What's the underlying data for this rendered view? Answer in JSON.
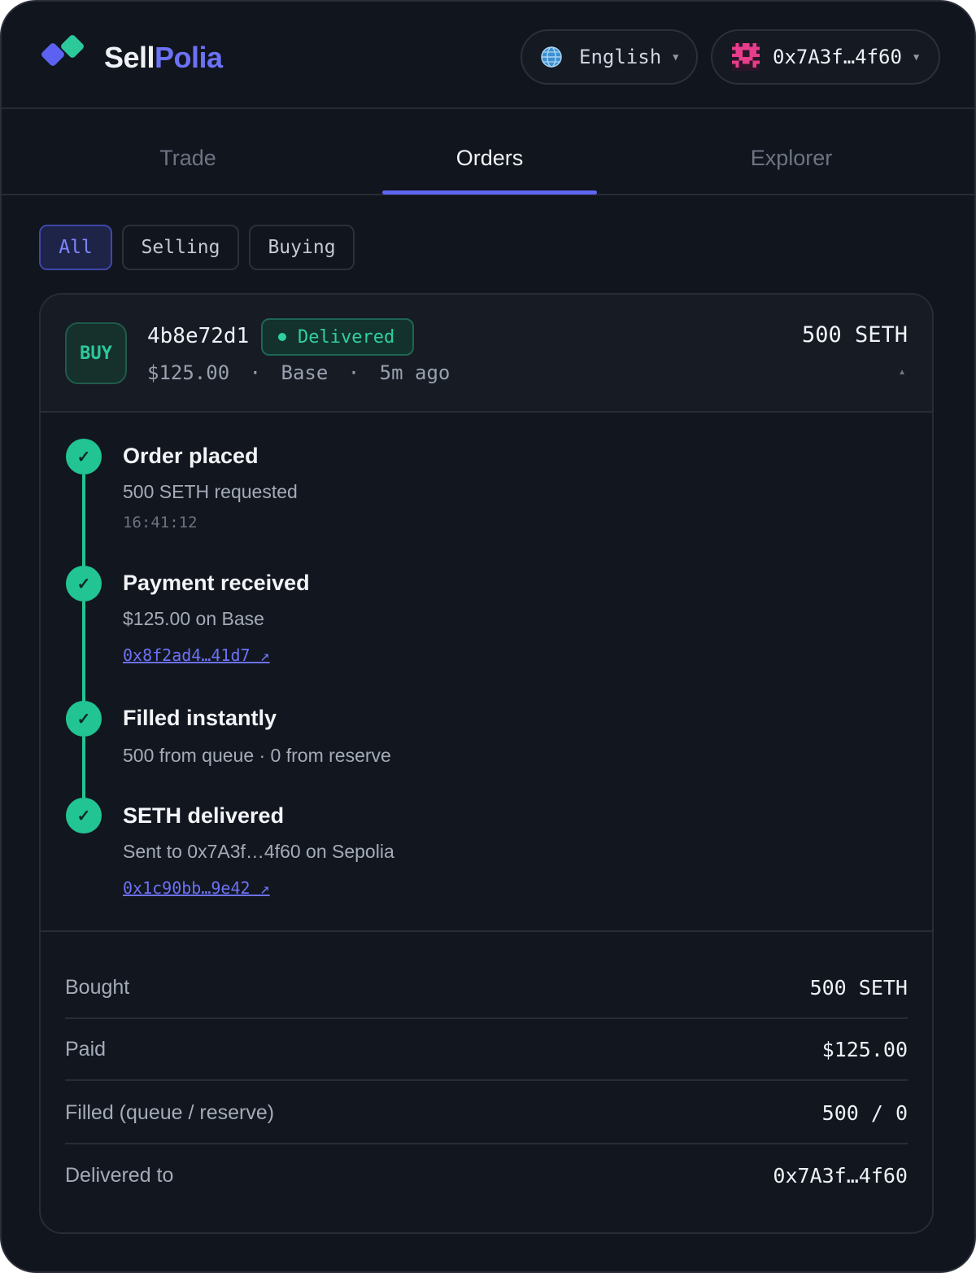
{
  "brand": {
    "part1": "Sell",
    "part2": "Polia"
  },
  "header": {
    "language": {
      "label": "English",
      "icon": "globe-icon"
    },
    "wallet": {
      "address": "0x7A3f…4f60",
      "icon": "wallet-avatar-icon"
    }
  },
  "tabs": [
    {
      "label": "Trade",
      "active": false
    },
    {
      "label": "Orders",
      "active": true
    },
    {
      "label": "Explorer",
      "active": false
    }
  ],
  "filters": [
    {
      "label": "All",
      "active": true
    },
    {
      "label": "Selling",
      "active": false
    },
    {
      "label": "Buying",
      "active": false
    }
  ],
  "order": {
    "side": "BUY",
    "id": "4b8e72d1",
    "status": "Delivered",
    "price": "$125.00",
    "chain": "Base",
    "age": "5m ago",
    "separator": "·",
    "amount": "500 SETH",
    "timeline": [
      {
        "title": "Order placed",
        "subtitle": "500 SETH requested",
        "time": "16:41:12"
      },
      {
        "title": "Payment received",
        "subtitle": "$125.00 on Base",
        "link": "0x8f2ad4…41d7 ↗"
      },
      {
        "title": "Filled instantly",
        "subtitle": "500 from queue · 0 from reserve"
      },
      {
        "title": "SETH delivered",
        "subtitle": "Sent to 0x7A3f…4f60 on Sepolia",
        "link": "0x1c90bb…9e42 ↗"
      }
    ],
    "summary": [
      {
        "label": "Bought",
        "value": "500 SETH"
      },
      {
        "label": "Paid",
        "value": "$125.00"
      },
      {
        "label": "Filled (queue / reserve)",
        "value": "500 / 0"
      },
      {
        "label": "Delivered to",
        "value": "0x7A3f…4f60"
      }
    ]
  },
  "colors": {
    "background": "#11151d",
    "accent": "#5f66f2",
    "success": "#22c493",
    "brand_secondary": "#2fd0a0"
  }
}
